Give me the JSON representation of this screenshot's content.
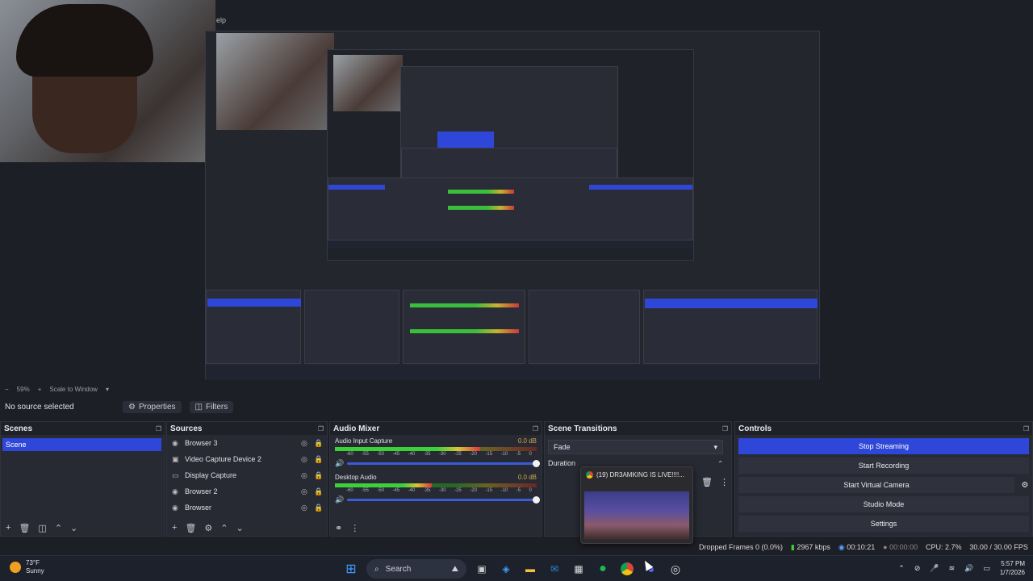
{
  "window_controls": {
    "minimize": "─",
    "maximize": "☐",
    "close": "✕"
  },
  "menu_fragment": "elp",
  "preview": {
    "zoom": "59%",
    "scale_mode": "Scale to Window"
  },
  "source_toolbar": {
    "status": "No source selected",
    "properties_label": "Properties",
    "filters_label": "Filters"
  },
  "scenes": {
    "title": "Scenes",
    "items": [
      {
        "label": "Scene",
        "selected": true
      }
    ]
  },
  "sources": {
    "title": "Sources",
    "items": [
      {
        "label": "Browser 3",
        "icon": "globe-icon"
      },
      {
        "label": "Video Capture Device 2",
        "icon": "camera-icon"
      },
      {
        "label": "Display Capture",
        "icon": "monitor-icon"
      },
      {
        "label": "Browser 2",
        "icon": "globe-icon"
      },
      {
        "label": "Browser",
        "icon": "globe-icon"
      }
    ]
  },
  "mixer": {
    "title": "Audio Mixer",
    "ticks": [
      "-60",
      "-55",
      "-50",
      "-45",
      "-40",
      "-35",
      "-30",
      "-25",
      "-20",
      "-15",
      "-10",
      "-5",
      "0"
    ],
    "channels": [
      {
        "name": "Audio Input Capture",
        "db": "0.0 dB",
        "level": 0.72
      },
      {
        "name": "Desktop Audio",
        "db": "0.0 dB",
        "level": 0.48
      }
    ]
  },
  "transitions": {
    "title": "Scene Transitions",
    "selected": "Fade",
    "duration_label": "Duration"
  },
  "controls": {
    "title": "Controls",
    "buttons": {
      "stop_streaming": "Stop Streaming",
      "start_recording": "Start Recording",
      "start_virtual_camera": "Start Virtual Camera",
      "studio_mode": "Studio Mode",
      "settings": "Settings"
    }
  },
  "popup": {
    "title": "(19) DR3AMKING IS LIVE!!!!..."
  },
  "status": {
    "dropped_frames": "Dropped Frames 0 (0.0%)",
    "bitrate": "2967 kbps",
    "stream_time": "00:10:21",
    "rec_time": "00:00:00",
    "cpu": "CPU: 2.7%",
    "fps": "30.00 / 30.00 FPS"
  },
  "taskbar": {
    "weather_temp": "73°F",
    "weather_desc": "Sunny",
    "search_label": "Search",
    "time": "5:57 PM",
    "date": "1/7/2026"
  },
  "colors": {
    "accent": "#2f47d8",
    "bg": "#1d1f26",
    "panel": "#272a33"
  }
}
